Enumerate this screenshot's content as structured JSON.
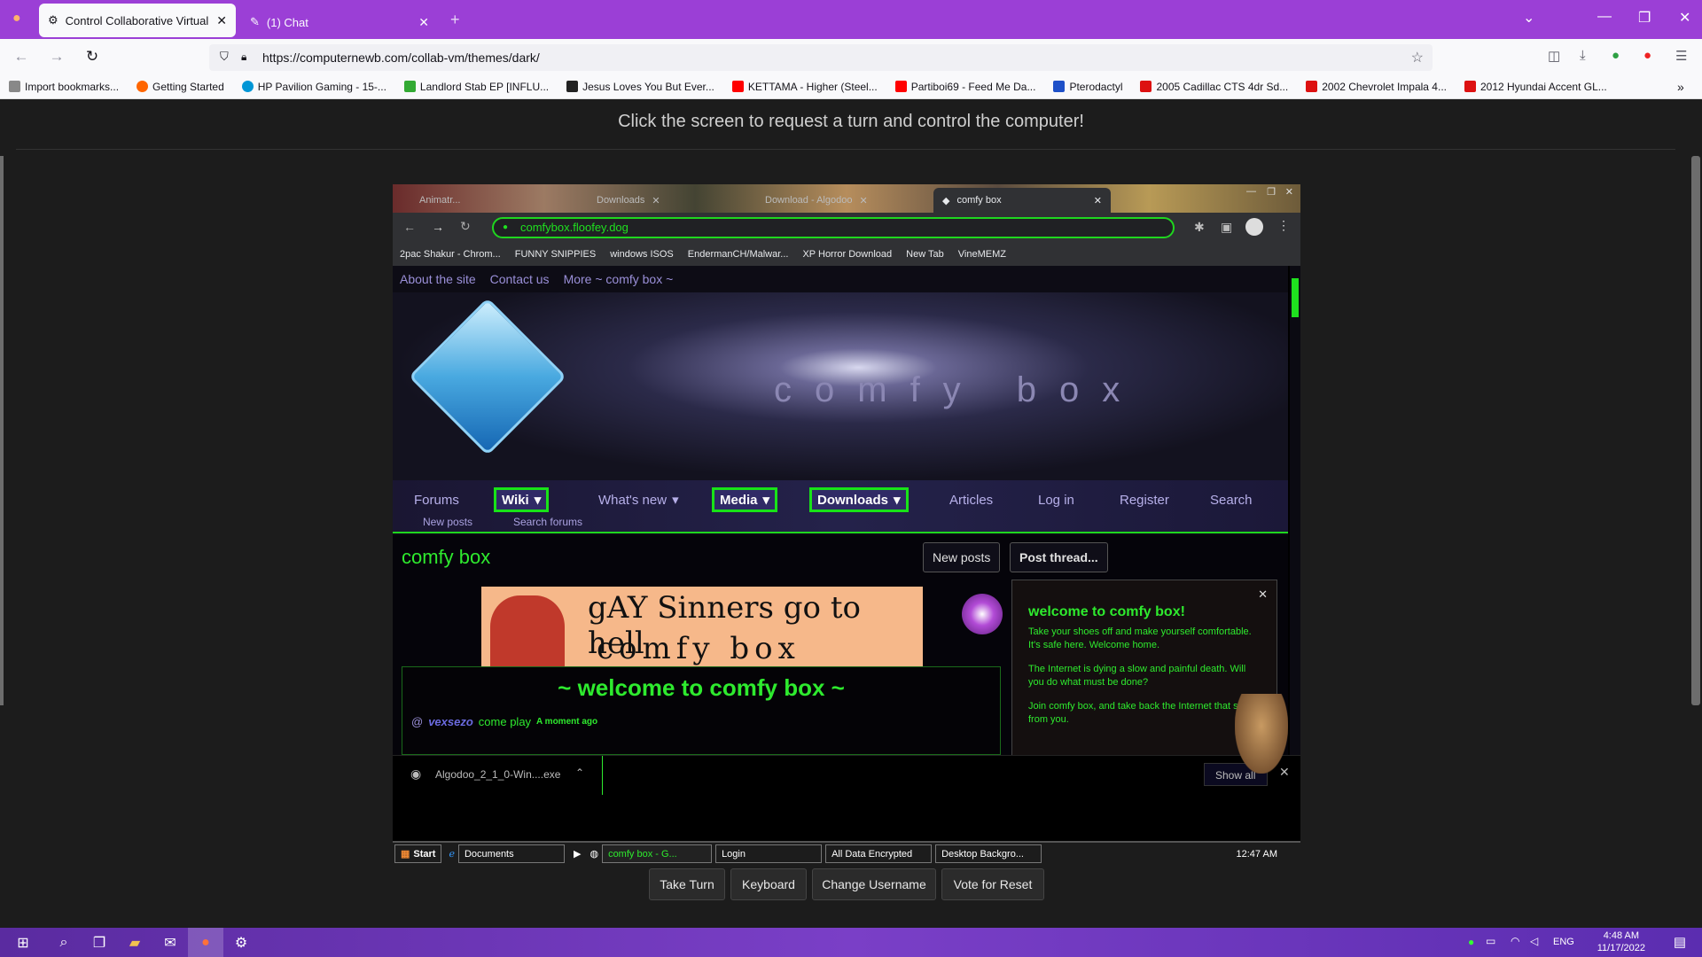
{
  "browser": {
    "tabs": [
      {
        "title": "Control Collaborative Virtual M...",
        "active": true
      },
      {
        "title": "(1) Chat",
        "active": false
      }
    ],
    "url": "https://computernewb.com/collab-vm/themes/dark/",
    "bookmarks": [
      "Import bookmarks...",
      "Getting Started",
      "HP Pavilion Gaming - 15-...",
      "Landlord Stab EP [INFLU...",
      "Jesus Loves You But Ever...",
      "KETTAMA - Higher (Steel...",
      "Partiboi69 - Feed Me Da...",
      "Pterodactyl",
      "2005 Cadillac CTS 4dr Sd...",
      "2002 Chevrolet Impala 4...",
      "2012 Hyundai Accent GL..."
    ]
  },
  "page": {
    "banner": "Click the screen to request a turn and control the computer!",
    "buttons": {
      "take_turn": "Take Turn",
      "keyboard": "Keyboard",
      "change_username": "Change Username",
      "vote_reset": "Vote for Reset"
    }
  },
  "vm": {
    "tabs": [
      "Animatr...",
      "Downloads",
      "Download - Algodoo",
      "comfy box"
    ],
    "url": "comfybox.floofey.dog",
    "bookmarks": [
      "2pac Shakur - Chrom...",
      "FUNNY SNIPPIES",
      "windows ISOS",
      "EndermanCH/Malwar...",
      "XP Horror Download",
      "New Tab",
      "VineMEMZ"
    ],
    "site": {
      "topnav": [
        "About the site",
        "Contact us",
        "More ~ comfy box ~"
      ],
      "hero_title": "comfy box",
      "menu": [
        "Forums",
        "Wiki",
        "What's new",
        "Media",
        "Downloads",
        "Articles",
        "Log in",
        "Register",
        "Search"
      ],
      "submenu": [
        "New posts",
        "Search forums"
      ],
      "page_title": "comfy box",
      "new_posts_btn": "New posts",
      "post_thread_btn": "Post thread...",
      "ad_line1": "gAY Sinners go to hell",
      "ad_line2": "comfy box",
      "welcome_heading": "~ welcome to comfy box ~",
      "post_prefix": "@",
      "post_user": "vexsezo",
      "post_text": "come play",
      "post_time": "A moment ago",
      "popup_title": "welcome to comfy box!",
      "popup_p1": "Take your shoes off and make yourself comfortable. It's safe here. Welcome home.",
      "popup_p2": "The Internet is dying a slow and painful death. Will you do what must be done?",
      "popup_p3": "Join comfy box, and take back the Internet that stolen from you."
    },
    "download_item": "Algodoo_2_1_0-Win....exe",
    "download_show": "Show all",
    "taskbar": {
      "start": "Start",
      "items": [
        "Documents",
        "comfy box - G...",
        "Login",
        "All Data Encrypted",
        "Desktop Backgro..."
      ],
      "time": "12:47 AM"
    }
  },
  "os_taskbar": {
    "lang": "ENG",
    "time": "4:48 AM",
    "date": "11/17/2022"
  },
  "colors": {
    "firefox_purple": "#9b3fd6",
    "site_green": "#2eea2e"
  }
}
